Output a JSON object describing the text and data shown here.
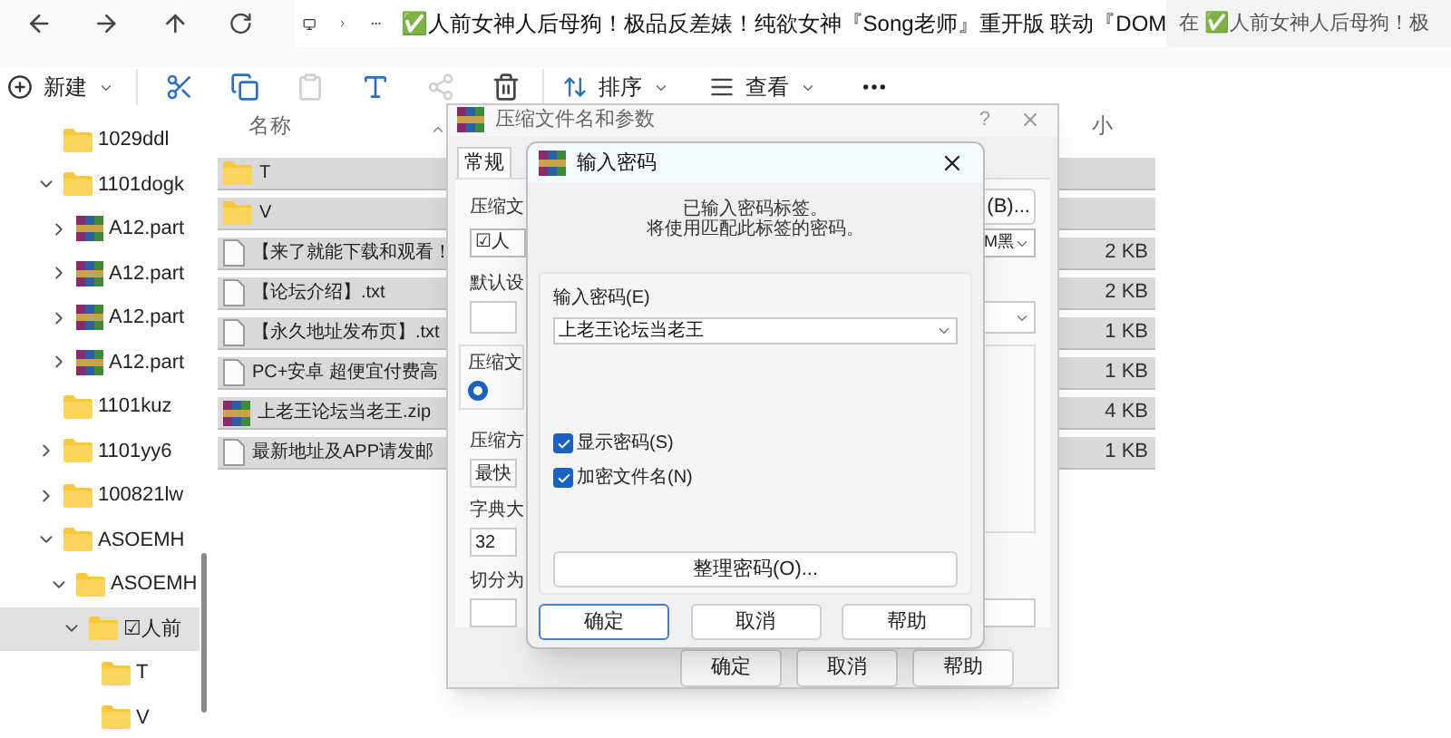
{
  "address_bar": {
    "breadcrumb": "✅人前女神人后母狗！极品反差婊！纯欲女神『Song老师』重开版 联动『DOM",
    "search": "在 ✅人前女神人后母狗！极"
  },
  "toolbar": {
    "new_label": "新建",
    "items": [
      {
        "kind": "cut",
        "disabled": false
      },
      {
        "kind": "copy",
        "disabled": false
      },
      {
        "kind": "paste",
        "disabled": true
      },
      {
        "kind": "rename",
        "disabled": false
      },
      {
        "kind": "share",
        "disabled": true
      },
      {
        "kind": "delete",
        "disabled": false
      }
    ],
    "sort_label": "排序",
    "view_label": "查看"
  },
  "tree": [
    {
      "label": "1029ddl",
      "kind": "folder",
      "expandable": false,
      "selected": false
    },
    {
      "label": "1101dogk",
      "kind": "folder",
      "expandable": true,
      "expanded": true,
      "selected": false,
      "children": [
        {
          "label": "A12.part",
          "kind": "archive",
          "expandable": true,
          "expanded": false,
          "selected": false
        },
        {
          "label": "A12.part",
          "kind": "archive",
          "expandable": true,
          "expanded": false,
          "selected": false
        },
        {
          "label": "A12.part",
          "kind": "archive",
          "expandable": true,
          "expanded": false,
          "selected": false
        },
        {
          "label": "A12.part",
          "kind": "archive",
          "expandable": true,
          "expanded": false,
          "selected": false
        }
      ]
    },
    {
      "label": "1101kuz",
      "kind": "folder",
      "expandable": false,
      "selected": false
    },
    {
      "label": "1101yy6",
      "kind": "folder",
      "expandable": true,
      "expanded": false,
      "selected": false
    },
    {
      "label": "100821lw",
      "kind": "folder",
      "expandable": true,
      "expanded": false,
      "selected": false
    },
    {
      "label": "ASOEMH",
      "kind": "folder",
      "expandable": true,
      "expanded": true,
      "selected": false,
      "children": [
        {
          "label": "ASOEMH",
          "kind": "folder",
          "expandable": true,
          "expanded": true,
          "selected": false,
          "children": [
            {
              "label": "☑人前",
              "kind": "folder",
              "expandable": true,
              "expanded": true,
              "selected": true,
              "children": [
                {
                  "label": "T",
                  "kind": "folder",
                  "expandable": false,
                  "selected": false
                },
                {
                  "label": "V",
                  "kind": "folder",
                  "expandable": false,
                  "selected": false
                }
              ]
            }
          ]
        }
      ]
    }
  ],
  "file_list": {
    "columns": [
      "名称",
      "小"
    ],
    "rows": [
      {
        "name": "T",
        "kind": "folder",
        "size": "",
        "selected": true
      },
      {
        "name": "V",
        "kind": "folder",
        "size": "",
        "selected": true
      },
      {
        "name": "【来了就能下载和观看！",
        "kind": "file",
        "size": "2 KB",
        "selected": true
      },
      {
        "name": "【论坛介绍】.txt",
        "kind": "file",
        "size": "2 KB",
        "selected": true
      },
      {
        "name": "【永久地址发布页】.txt",
        "kind": "file",
        "size": "1 KB",
        "selected": true
      },
      {
        "name": "PC+安卓 超便宜付费高",
        "kind": "file",
        "size": "1 KB",
        "selected": true
      },
      {
        "name": "上老王论坛当老王.zip",
        "kind": "archive",
        "size": "4 KB",
        "selected": true
      },
      {
        "name": "最新地址及APP请发邮",
        "kind": "file",
        "size": "1 KB",
        "selected": true
      }
    ]
  },
  "archive_dialog": {
    "title": "压缩文件名和参数",
    "help": "?",
    "tabs": [
      {
        "label": "常规",
        "selected": true
      }
    ],
    "name_label": "压缩文",
    "name_value": "☑人",
    "browse_button": "(B)...",
    "name_tail": "M黑",
    "profile_label": "默认设",
    "group_label": "压缩文",
    "format_selected": true,
    "method_label": "压缩方",
    "method_value": "最快",
    "dict_label": "字典大",
    "dict_value": "32",
    "split_label": "切分为",
    "buttons": [
      "确定",
      "取消",
      "帮助"
    ]
  },
  "password_dialog": {
    "title": "输入密码",
    "message": [
      "已输入密码标签。",
      "将使用匹配此标签的密码。"
    ],
    "password_label": "输入密码(E)",
    "password_value": "上老王论坛当老王",
    "options": [
      {
        "label": "显示密码(S)",
        "checked": true
      },
      {
        "label": "加密文件名(N)",
        "checked": true
      }
    ],
    "organize_button": "整理密码(O)...",
    "buttons": [
      {
        "label": "确定",
        "default": true
      },
      {
        "label": "取消",
        "default": false
      },
      {
        "label": "帮助",
        "default": false
      }
    ]
  }
}
